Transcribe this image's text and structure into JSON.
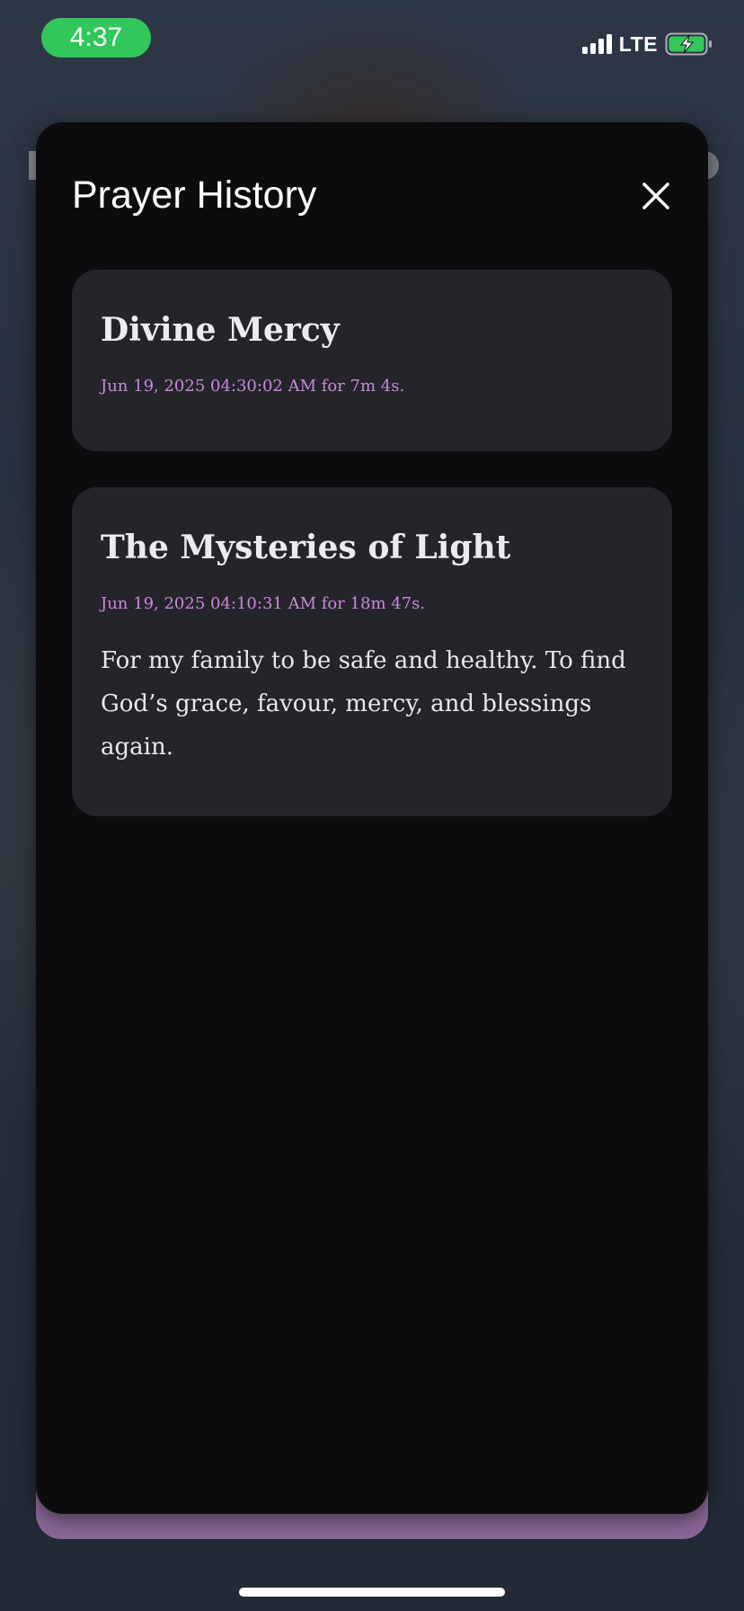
{
  "status_bar": {
    "time": "4:37",
    "network": "LTE",
    "signal_bars": 4,
    "battery_charging": true,
    "time_pill_color": "#30c85a"
  },
  "sheet": {
    "title": "Prayer History",
    "close_icon": "close-icon"
  },
  "history": [
    {
      "title": "Divine Mercy",
      "meta": "Jun 19, 2025 04:30:02 AM for 7m 4s.",
      "intention": ""
    },
    {
      "title": "The Mysteries of Light",
      "meta": "Jun 19, 2025 04:10:31 AM for 18m 47s.",
      "intention": "For my family to be safe and healthy. To find God’s grace, favour, mercy, and blessings again."
    }
  ],
  "colors": {
    "sheet_background": "#0c0c0f",
    "card_background": "#25242b",
    "meta_accent": "#c98ad6",
    "underlay_accent": "#8d6899"
  }
}
